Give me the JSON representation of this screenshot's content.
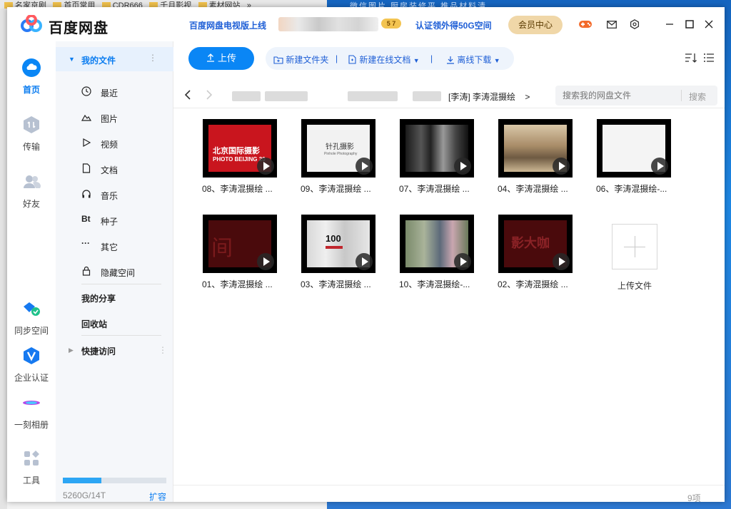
{
  "background": {
    "tabs": [
      "名家京剧",
      "首页常用",
      "CDR666",
      "千月影视",
      "素材网站",
      "»"
    ],
    "right_text": "微信图片  厨房装修平  推品材料清"
  },
  "app": {
    "title": "百度网盘",
    "tv_promo": "百度网盘电视版上线",
    "vip_level": "5 7",
    "storage_promo": "认证领外得50G空间",
    "member_center": "会员中心",
    "icons": [
      "game-icon",
      "mail-icon",
      "settings-icon",
      "minimize-icon",
      "maximize-icon",
      "close-icon"
    ]
  },
  "nav": {
    "home": "首页",
    "transfer": "传输",
    "friends": "好友",
    "sync": "同步空间",
    "enterprise": "企业认证",
    "album": "一刻相册",
    "tools": "工具"
  },
  "tree": {
    "my_files": "我的文件",
    "items": [
      {
        "label": "最近",
        "icon": "clock-icon"
      },
      {
        "label": "图片",
        "icon": "image-icon"
      },
      {
        "label": "视频",
        "icon": "video-icon"
      },
      {
        "label": "文档",
        "icon": "document-icon"
      },
      {
        "label": "音乐",
        "icon": "headphones-icon"
      },
      {
        "label": "种子",
        "icon": "bt-icon"
      },
      {
        "label": "其它",
        "icon": "more-icon"
      },
      {
        "label": "隐藏空间",
        "icon": "lock-icon"
      }
    ],
    "my_share": "我的分享",
    "recycle": "回收站",
    "quick_access": "快捷访问",
    "quota": "5260G/14T",
    "quota_fraction": 0.37,
    "expand": "扩容",
    "bt_glyph": "Bt",
    "more_glyph": "···"
  },
  "toolbar": {
    "upload": "上传",
    "new_folder": "新建文件夹",
    "new_doc": "新建在线文档",
    "offline": "离线下载"
  },
  "address": {
    "current": "[李涛] 李涛混摄绘",
    "chevron": ">",
    "search_placeholder": "搜索我的网盘文件",
    "search_button": "搜索"
  },
  "files": [
    {
      "name": "08、李涛混摄绘 ...",
      "thumb_title": "北京国际摄影",
      "thumb_sub": "PHOTO BEIJING 20"
    },
    {
      "name": "09、李涛混摄绘 ...",
      "thumb_title": "针孔摄影",
      "thumb_sub": "Pinhole Photography"
    },
    {
      "name": "07、李涛混摄绘 ...",
      "thumb_title": "",
      "thumb_sub": ""
    },
    {
      "name": "04、李涛混摄绘 ...",
      "thumb_title": "",
      "thumb_sub": ""
    },
    {
      "name": "06、李涛混摄绘-...",
      "thumb_title": "",
      "thumb_sub": ""
    },
    {
      "name": "01、李涛混摄绘 ...",
      "thumb_title": "间",
      "thumb_sub": ""
    },
    {
      "name": "03、李涛混摄绘 ...",
      "thumb_title": "100",
      "thumb_sub": ""
    },
    {
      "name": "10、李涛混摄绘-...",
      "thumb_title": "",
      "thumb_sub": ""
    },
    {
      "name": "02、李涛混摄绘 ...",
      "thumb_title": "影大咖",
      "thumb_sub": ""
    }
  ],
  "upload_tile": "上传文件",
  "item_count": "9项"
}
